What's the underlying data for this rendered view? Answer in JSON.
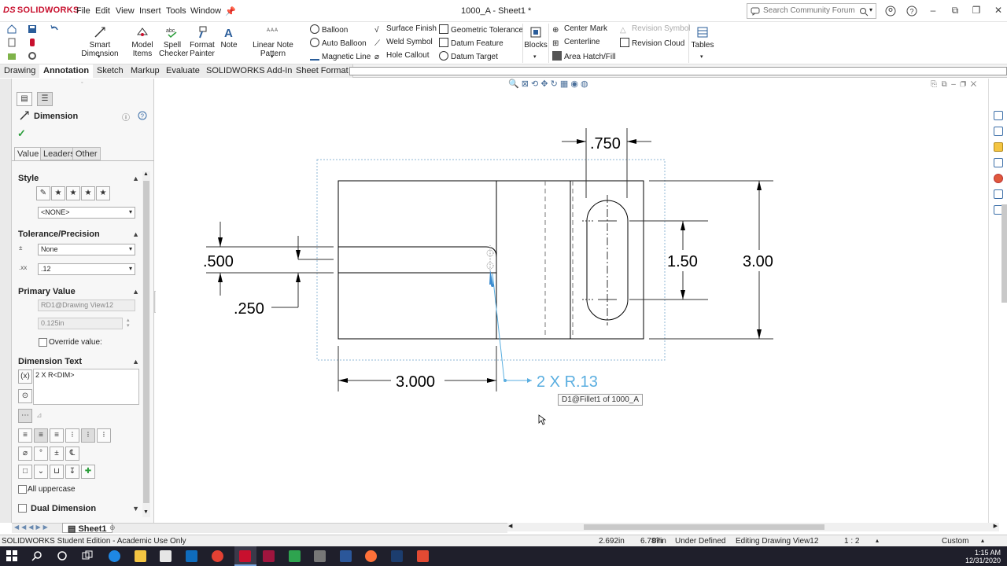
{
  "app": {
    "logo_text": "SOLIDWORKS",
    "logo_prefix": "DS",
    "document_title": "1000_A - Sheet1 *"
  },
  "menu": [
    "File",
    "Edit",
    "View",
    "Insert",
    "Tools",
    "Window"
  ],
  "search": {
    "placeholder": "Search Community Forum"
  },
  "ribbon": {
    "smart_dimension": "Smart Dimension",
    "model_items_1": "Model",
    "model_items_2": "Items",
    "spell_checker_1": "Spell",
    "spell_checker_2": "Checker",
    "format_painter_1": "Format",
    "format_painter_2": "Painter",
    "note": "Note",
    "linear_note_pattern": "Linear Note Pattern",
    "balloon": "Balloon",
    "auto_balloon": "Auto Balloon",
    "magnetic_line": "Magnetic Line",
    "surface_finish": "Surface Finish",
    "weld_symbol": "Weld Symbol",
    "hole_callout": "Hole Callout",
    "geometric_tolerance": "Geometric Tolerance",
    "datum_feature": "Datum Feature",
    "datum_target": "Datum Target",
    "blocks": "Blocks",
    "center_mark": "Center Mark",
    "centerline": "Centerline",
    "area_hatch": "Area Hatch/Fill",
    "revision_symbol": "Revision Symbol",
    "revision_cloud": "Revision Cloud",
    "tables": "Tables"
  },
  "tabs": [
    "Drawing",
    "Annotation",
    "Sketch",
    "Markup",
    "Evaluate",
    "SOLIDWORKS Add-Ins",
    "Sheet Format"
  ],
  "property_manager": {
    "title": "Dimension",
    "subtabs": [
      "Value",
      "Leaders",
      "Other"
    ],
    "style": {
      "header": "Style",
      "combo_value": "<NONE>"
    },
    "tolerance": {
      "header": "Tolerance/Precision",
      "tolerance_value": "None",
      "precision_value": ".12"
    },
    "primary_value": {
      "header": "Primary Value",
      "reference": "RD1@Drawing View12",
      "value": "0.125in",
      "override_label": "Override value:"
    },
    "dimension_text": {
      "header": "Dimension Text",
      "text": "2 X R<DIM>",
      "all_uppercase_label": "All uppercase"
    },
    "dual_dimension": {
      "header": "Dual Dimension"
    }
  },
  "drawing": {
    "dims": {
      "d_750": ".750",
      "d_150": "1.50",
      "d_300": "3.00",
      "d_500": ".500",
      "d_250": ".250",
      "d_3000": "3.000",
      "fillet": "2 X R.13"
    },
    "tooltip": "D1@Fillet1 of 1000_A"
  },
  "sheet_tab": "Sheet1",
  "status": {
    "edition": "SOLIDWORKS Student Edition - Academic Use Only",
    "x": "2.692in",
    "y": "6.787in",
    "z": "0in",
    "state": "Under Defined",
    "editing": "Editing Drawing View12",
    "scale": "1 : 2",
    "units": "Custom"
  },
  "clock": {
    "time": "1:15 AM",
    "date": "12/31/2020"
  },
  "colors": {
    "accent_red": "#c8102e",
    "dim_blue": "#5aaee0",
    "drawing_line": "#000000"
  }
}
